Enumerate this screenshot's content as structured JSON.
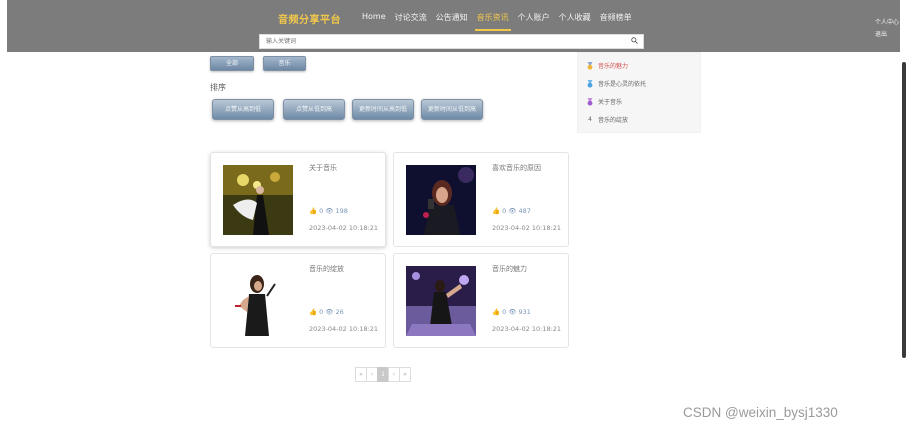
{
  "header": {
    "brand": "音频分享平台",
    "nav": [
      "Home",
      "讨论交流",
      "公告通知",
      "音乐资讯",
      "个人账户",
      "个人收藏",
      "音频榜单"
    ],
    "active_nav": "音乐资讯",
    "user_links": [
      "个人中心",
      "退出"
    ],
    "search_placeholder": "输入关键词"
  },
  "filters": {
    "all": "全部",
    "category": "音乐"
  },
  "sort": {
    "label": "排序",
    "buttons": [
      "点赞从高到低",
      "点赞从低到高",
      "更新时间从高到低",
      "更新时间从低到高"
    ]
  },
  "sidebar": {
    "items": [
      "音乐的魅力",
      "音乐是心灵的依托",
      "关于音乐",
      "音乐的绽放"
    ]
  },
  "cards": [
    {
      "title": "关于音乐",
      "likes": "0",
      "views": "198",
      "date": "2023-04-02 10:18:21"
    },
    {
      "title": "喜欢音乐的原因",
      "likes": "0",
      "views": "487",
      "date": "2023-04-02 10:18:21"
    },
    {
      "title": "音乐的绽放",
      "likes": "0",
      "views": "26",
      "date": "2023-04-02 10:18:21"
    },
    {
      "title": "音乐的魅力",
      "likes": "0",
      "views": "931",
      "date": "2023-04-02 10:18:21"
    }
  ],
  "pagination": {
    "first": "«",
    "prev": "‹",
    "current": "1",
    "next": "›",
    "last": "»"
  },
  "watermark": "CSDN @weixin_bysj1330",
  "colors": {
    "header_bg": "#7c7c7c",
    "brand": "#f2c84b",
    "button": "#6d87a3"
  }
}
